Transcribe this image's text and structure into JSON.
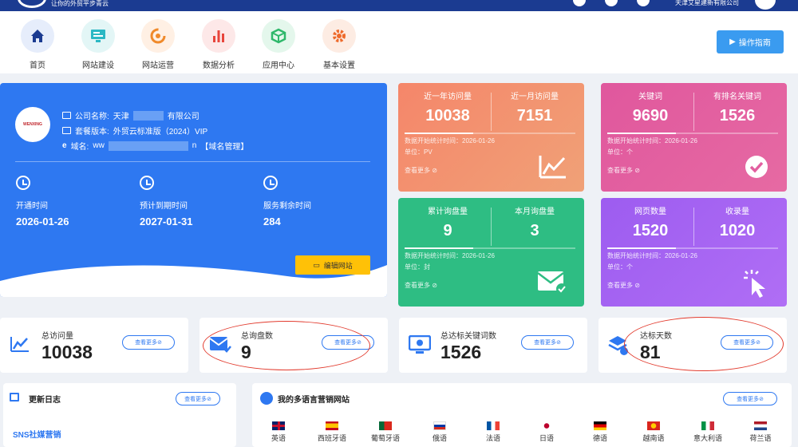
{
  "topbar": {
    "slogan": "让你的外贸平步青云",
    "company": "天津艾星建新有限公司"
  },
  "nav": [
    {
      "label": "首页",
      "icon": "home-icon",
      "bg": "#e6edfb",
      "color": "#1b3b91"
    },
    {
      "label": "网站建设",
      "icon": "monitor-icon",
      "bg": "#e3f6f6",
      "color": "#2bb8c4"
    },
    {
      "label": "网站运营",
      "icon": "cycle-icon",
      "bg": "#fff0e4",
      "color": "#f08a2b"
    },
    {
      "label": "数据分析",
      "icon": "bar-chart-icon",
      "bg": "#fde8e8",
      "color": "#e8453c"
    },
    {
      "label": "应用中心",
      "icon": "cube-icon",
      "bg": "#e4f7ec",
      "color": "#2fb86b"
    },
    {
      "label": "基本设置",
      "icon": "gear-icon",
      "bg": "#fdece3",
      "color": "#ee6a2b"
    }
  ],
  "guide_label": "操作指南",
  "company": {
    "logo_text": "WENXING",
    "name_label": "公司名称:",
    "name_prefix": "天津",
    "name_suffix": "有限公司",
    "package_label": "套餐版本:",
    "package_value": "外贸云标准版（2024）VIP",
    "domain_label": "域名:",
    "domain_prefix": "ww",
    "domain_suffix": "n",
    "domain_link": "【域名管理】",
    "dates": [
      {
        "label": "开通时间",
        "value": "2026-01-26"
      },
      {
        "label": "预计到期时间",
        "value": "2027-01-31"
      },
      {
        "label": "服务剩余时间",
        "value": "284"
      }
    ],
    "site_button": "编辑网站"
  },
  "stats": [
    {
      "h1": "近一年访问量",
      "v1": "10038",
      "h2": "近一月访问量",
      "v2": "7151",
      "t1": "数据开始统计时间：2026-01-26",
      "t2": "单位：PV",
      "more": "查看更多",
      "icon": "trend-chart-icon",
      "color": "#f28a6c"
    },
    {
      "h1": "关键词",
      "v1": "9690",
      "h2": "有排名关键词",
      "v2": "1526",
      "t1": "数据开始统计时间：2026-01-26",
      "t2": "单位：个",
      "more": "查看更多",
      "icon": "check-circle-icon",
      "color": "#e25fa0"
    },
    {
      "h1": "累计询盘量",
      "v1": "9",
      "h2": "本月询盘量",
      "v2": "3",
      "t1": "数据开始统计时间：2026-01-26",
      "t2": "单位：封",
      "more": "查看更多",
      "icon": "mail-check-icon",
      "color": "#2ebd83"
    },
    {
      "h1": "网页数量",
      "v1": "1520",
      "h2": "收录量",
      "v2": "1020",
      "t1": "数据开始统计时间：2026-01-26",
      "t2": "单位：个",
      "more": "查看更多",
      "icon": "click-pointer-icon",
      "color": "#a463f0"
    }
  ],
  "summary": [
    {
      "label": "总访问量",
      "value": "10038",
      "button": "查看更多",
      "icon": "trend-icon"
    },
    {
      "label": "总询盘数",
      "value": "9",
      "button": "查看更多",
      "icon": "mail-icon"
    },
    {
      "label": "总达标关键词数",
      "value": "1526",
      "button": "查看更多",
      "icon": "monitor-icon"
    },
    {
      "label": "达标天数",
      "value": "81",
      "button": "查看更多",
      "icon": "layers-icon"
    }
  ],
  "update_log": {
    "title": "更新日志",
    "button": "查看更多",
    "first_item": "SNS社媒营销"
  },
  "multilang": {
    "title": "我的多语言营销网站",
    "button": "查看更多",
    "languages": [
      "英语",
      "西班牙语",
      "葡萄牙语",
      "俄语",
      "法语",
      "日语",
      "德语",
      "越南语",
      "意大利语",
      "荷兰语"
    ]
  }
}
